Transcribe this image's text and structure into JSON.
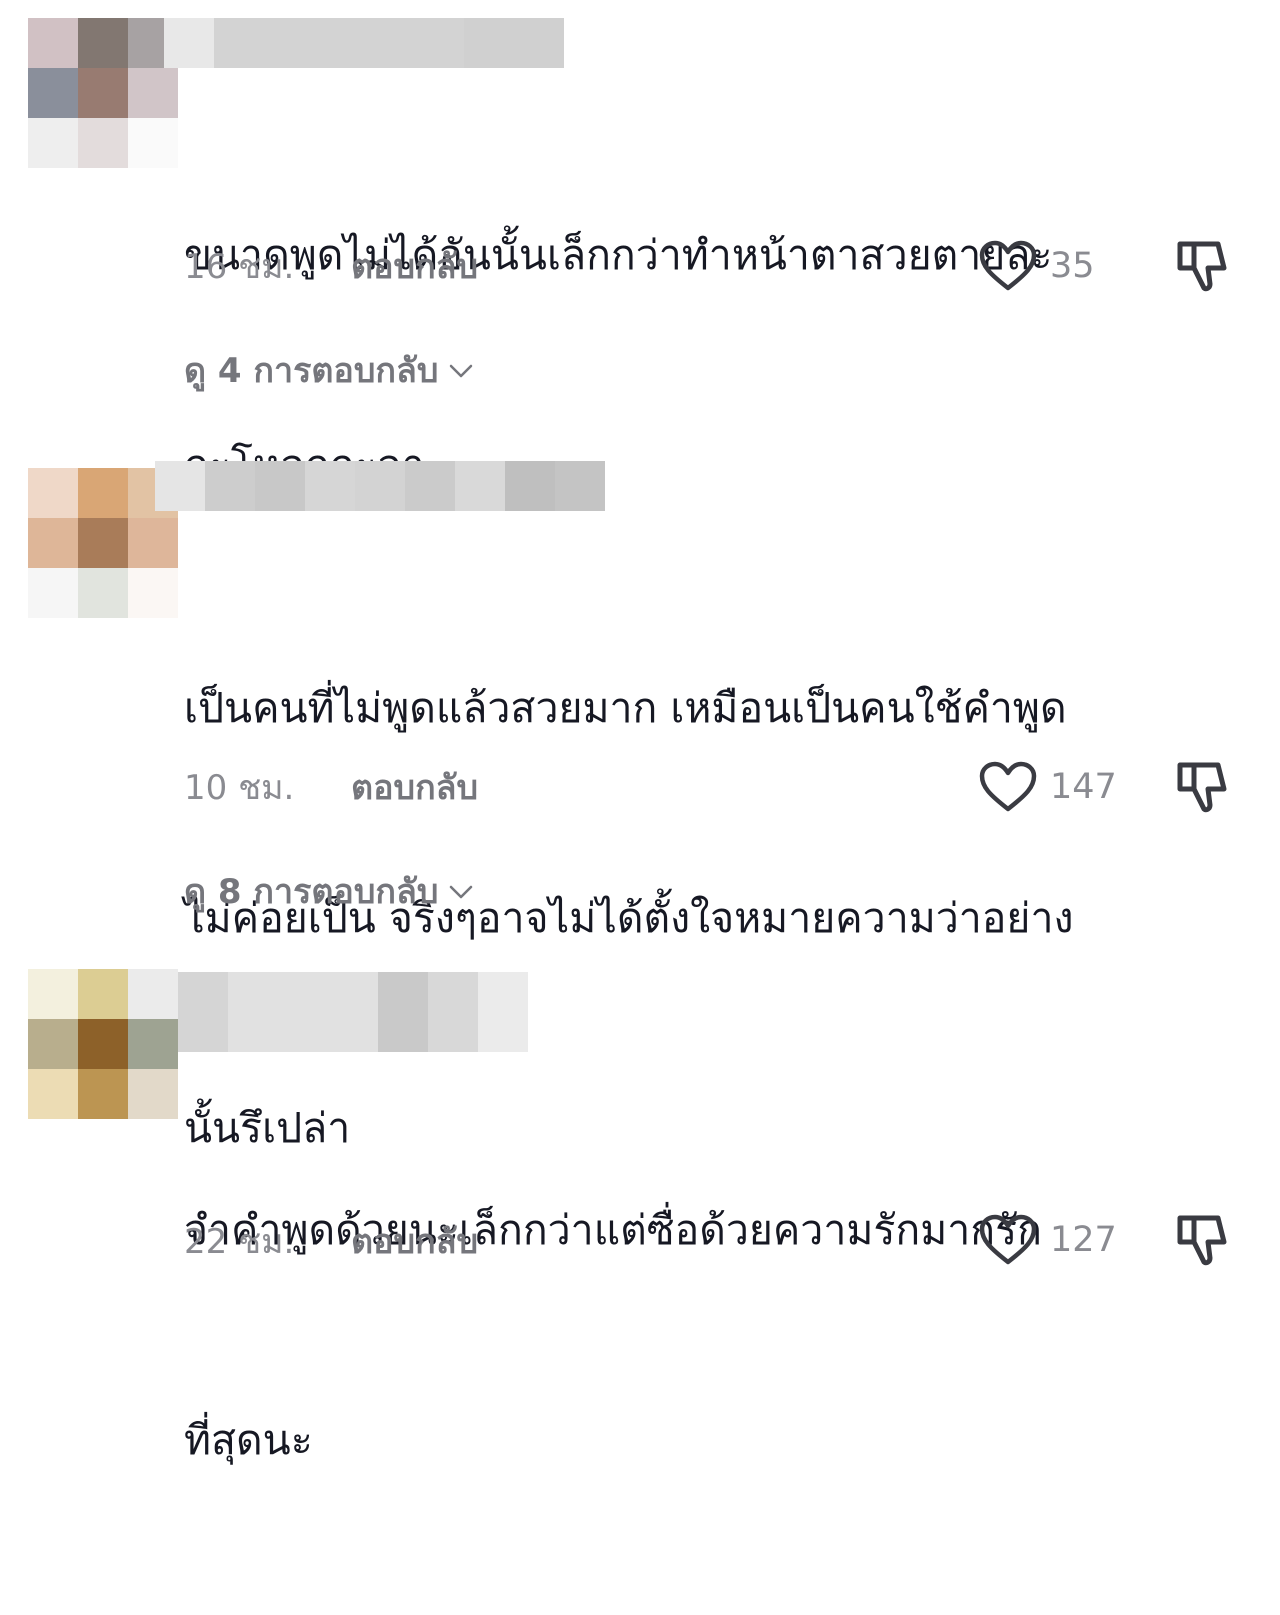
{
  "colors": {
    "text": "#161823",
    "muted": "#8a8b91",
    "link": "#75767c"
  },
  "comments": [
    {
      "text_line1": "ขนาดพูดไม่ได้อันนั้นเล็กกว่าทำหน้าตาสวยตายละ",
      "text_line2": "กะโหลกกะลา",
      "text_line3": "",
      "time": "16 ชม.",
      "reply": "ตอบกลับ",
      "likes": "35",
      "view_replies": "ดู 4 การตอบกลับ",
      "avatar_colors": [
        "#d1c1c4",
        "#827771",
        "#a7a2a3",
        "#8a8f9b",
        "#987b71",
        "#d1c5c8",
        "#eeeeee",
        "#e3dcdc",
        "#fafafa"
      ],
      "name_colors": [
        "#e8e8e8",
        "#d3d3d3",
        "#d3d3d3",
        "#d3d3d3",
        "#d0d0d0",
        "#d0d0d0",
        "#cfcfcf",
        "#ececec"
      ]
    },
    {
      "text_line1": "เป็นคนที่ไม่พูดแล้วสวยมาก เหมือนเป็นคนใช้คำพูด",
      "text_line2": "ไม่ค่อยเป็น จริงๆอาจไม่ได้ตั้งใจหมายความว่าอย่าง",
      "text_line3": "นั้นรึเปล่า",
      "time": "10 ชม.",
      "reply": "ตอบกลับ",
      "likes": "147",
      "view_replies": "ดู 8 การตอบกลับ",
      "avatar_colors": [
        "#efd8c8",
        "#d9a675",
        "#e2c3a4",
        "#deb698",
        "#a97c59",
        "#deb69a",
        "#f6f6f6",
        "#e1e4de",
        "#fbf7f4"
      ],
      "name_colors": [
        "#e5e5e5",
        "#cdcdcd",
        "#c8c8c8",
        "#d6d6d6",
        "#d3d3d3",
        "#cbcbcb",
        "#d9d9d9",
        "#bfbfbf",
        "#c4c4c4"
      ]
    },
    {
      "text_line1": "จำคำพูดด้วยนะเล็กกว่าแต่ซื่อด้วยความรักมากรัก",
      "text_line2": "ที่สุดนะ",
      "text_line3": "",
      "time": "22 ชม.",
      "reply": "ตอบกลับ",
      "likes": "127",
      "view_replies": "",
      "avatar_colors": [
        "#f3f0de",
        "#dccd93",
        "#ebebeb",
        "#b8ae8d",
        "#8d6129",
        "#9ea392",
        "#ecdcb4",
        "#bc9552",
        "#e2d9c9"
      ],
      "name_colors": [
        "#d5d5d5",
        "#e1e1e1",
        "#e1e1e1",
        "#c9c9c9",
        "#d8d8d8",
        "#ebebeb"
      ]
    }
  ]
}
